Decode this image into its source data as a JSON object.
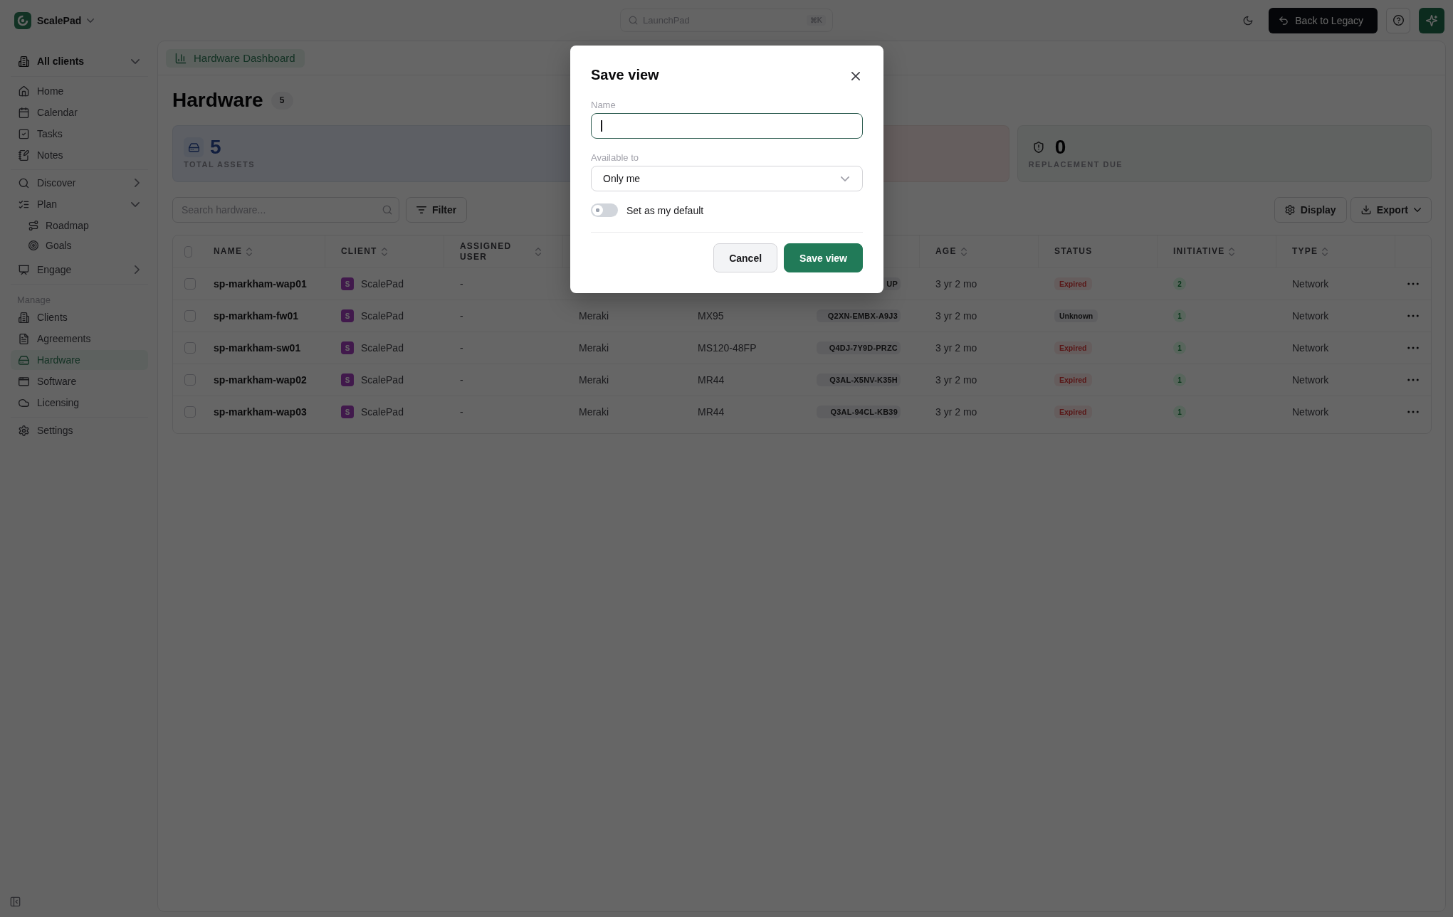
{
  "top_bar": {
    "brand": "ScalePad",
    "search": {
      "placeholder": "LaunchPad",
      "shortcut": "⌘K"
    },
    "legacy_button": "Back to Legacy"
  },
  "sidebar": {
    "client_switcher": "All clients",
    "groups": [
      {
        "items": [
          {
            "label": "Home",
            "selected": false
          },
          {
            "label": "Calendar",
            "selected": false
          },
          {
            "label": "Tasks",
            "selected": false
          },
          {
            "label": "Notes",
            "selected": false
          }
        ]
      },
      {
        "items": [
          {
            "label": "Discover",
            "selected": false,
            "expanded": false
          },
          {
            "label": "Plan",
            "selected": false,
            "expanded": true,
            "children": [
              {
                "label": "Roadmap",
                "selected": false
              },
              {
                "label": "Goals",
                "selected": false
              }
            ]
          },
          {
            "label": "Engage",
            "selected": false,
            "expanded": false
          }
        ]
      },
      {
        "heading": "Manage",
        "items": [
          {
            "label": "Clients",
            "selected": false
          },
          {
            "label": "Agreements",
            "selected": false
          },
          {
            "label": "Hardware",
            "selected": true
          },
          {
            "label": "Software",
            "selected": false
          },
          {
            "label": "Licensing",
            "selected": false
          }
        ]
      },
      {
        "items": [
          {
            "label": "Settings",
            "selected": false
          }
        ]
      }
    ]
  },
  "tabs": [
    {
      "label": "Hardware Dashboard",
      "selected": true
    }
  ],
  "page": {
    "title": "Hardware",
    "count": "5"
  },
  "stats": [
    {
      "kind": "assets",
      "value": "5",
      "label": "TOTAL ASSETS"
    },
    {
      "kind": "alert"
    },
    {
      "kind": "replacement",
      "value": "0",
      "label": "REPLACEMENT DUE"
    }
  ],
  "toolbar": {
    "search": {
      "placeholder": "Search hardware..."
    },
    "filter_button": "Filter",
    "display_button": "Display",
    "export_button": "Export"
  },
  "table": {
    "select_all": {
      "checked": false
    },
    "columns": {
      "name": {
        "label": "NAME",
        "sortable": true
      },
      "client": {
        "label": "CLIENT",
        "sortable": true
      },
      "assigned_user": {
        "label": "ASSIGNED USER",
        "sortable": true
      },
      "age": {
        "label": "AGE",
        "sortable": true
      },
      "status": {
        "label": "STATUS",
        "sortable": false
      },
      "initiative": {
        "label": "INITIATIVE",
        "sortable": true
      },
      "type": {
        "label": "TYPE",
        "sortable": true
      }
    },
    "rows": [
      {
        "checked": false,
        "name": "sp-markham-wap01",
        "client": {
          "initial": "S",
          "name": "ScalePad"
        },
        "assigned_user": "-",
        "column_6": "UP",
        "age": "3 yr 2 mo",
        "status": {
          "label": "Expired",
          "kind": "danger"
        },
        "initiative": "2",
        "type": "Network"
      },
      {
        "checked": false,
        "name": "sp-markham-fw01",
        "client": {
          "initial": "S",
          "name": "ScalePad"
        },
        "assigned_user": "-",
        "column_4": "Meraki",
        "column_5": "MX95",
        "column_6": "Q2XN-EMBX-A9J3",
        "age": "3 yr 2 mo",
        "status": {
          "label": "Unknown",
          "kind": "neutral"
        },
        "initiative": "1",
        "type": "Network"
      },
      {
        "checked": false,
        "name": "sp-markham-sw01",
        "client": {
          "initial": "S",
          "name": "ScalePad"
        },
        "assigned_user": "-",
        "column_4": "Meraki",
        "column_5": "MS120-48FP",
        "column_6": "Q4DJ-7Y9D-PRZC",
        "age": "3 yr 2 mo",
        "status": {
          "label": "Expired",
          "kind": "danger"
        },
        "initiative": "1",
        "type": "Network"
      },
      {
        "checked": false,
        "name": "sp-markham-wap02",
        "client": {
          "initial": "S",
          "name": "ScalePad"
        },
        "assigned_user": "-",
        "column_4": "Meraki",
        "column_5": "MR44",
        "column_6": "Q3AL-X5NV-K35H",
        "age": "3 yr 2 mo",
        "status": {
          "label": "Expired",
          "kind": "danger"
        },
        "initiative": "1",
        "type": "Network"
      },
      {
        "checked": false,
        "name": "sp-markham-wap03",
        "client": {
          "initial": "S",
          "name": "ScalePad"
        },
        "assigned_user": "-",
        "column_4": "Meraki",
        "column_5": "MR44",
        "column_6": "Q3AL-94CL-KB39",
        "age": "3 yr 2 mo",
        "status": {
          "label": "Expired",
          "kind": "danger"
        },
        "initiative": "1",
        "type": "Network"
      }
    ]
  },
  "modal": {
    "title": "Save view",
    "name_field": {
      "label": "Name",
      "focused": true
    },
    "visibility_field": {
      "label": "Available to",
      "value": "Only me"
    },
    "default_toggle": {
      "label": "Set as my default",
      "on": false
    },
    "buttons": [
      {
        "kind": "secondary",
        "label": "Cancel"
      },
      {
        "kind": "primary",
        "label": "Save view"
      }
    ]
  }
}
